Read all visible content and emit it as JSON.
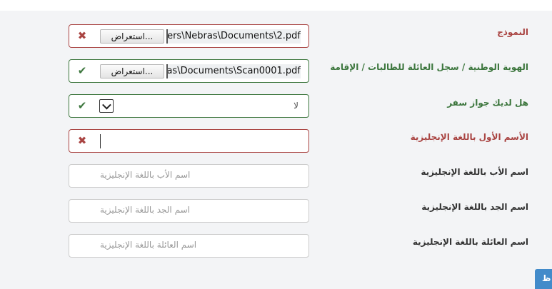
{
  "form": {
    "rows": [
      {
        "label": "النموذج",
        "state": "error",
        "file_name": "ers\\Nebras\\Documents\\2.pdf",
        "browse_label": "...استعراض"
      },
      {
        "label": "الهوية الوطنية / سجل العائلة للطالبات / الإقامة",
        "state": "success",
        "file_name": "as\\Documents\\Scan0001.pdf",
        "browse_label": "...استعراض"
      },
      {
        "label": "هل لديك جواز سفر",
        "state": "success",
        "selected": "لا"
      },
      {
        "label": "الأسم الأول باللغة الإنجليزية",
        "state": "error",
        "value": ""
      },
      {
        "label": "اسم الأب باللغة الإنجليزية",
        "placeholder": "اسم الأب باللغة الإنجليزية"
      },
      {
        "label": "اسم الجد باللغة الإنجليزية",
        "placeholder": "اسم الجد باللغة الإنجليزية"
      },
      {
        "label": "اسم العائلة باللغة الإنجليزية",
        "placeholder": "اسم العائلة باللغة الإنجليزية"
      }
    ]
  },
  "save_button": {
    "label": "ظ"
  },
  "colors": {
    "error": "#a94442",
    "success": "#3c763d",
    "primary": "#428bca"
  }
}
